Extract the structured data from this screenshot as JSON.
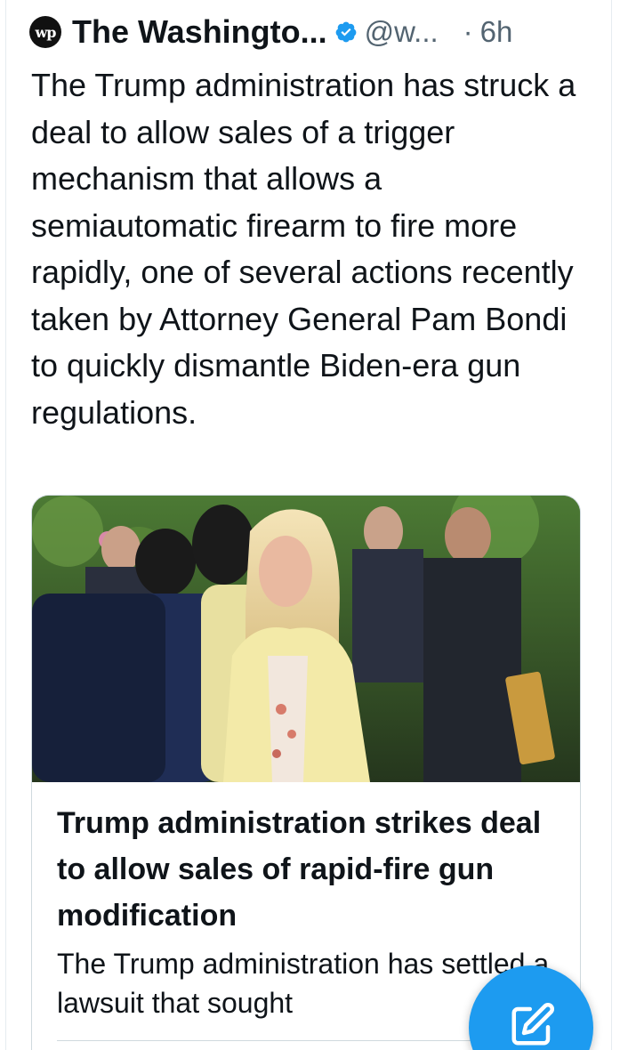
{
  "tweet": {
    "author_name": "The Washingto...",
    "logo_text": "wp",
    "handle": "@w...",
    "separator": "·",
    "time": "6h",
    "text": "The Trump administration has struck a deal to allow sales of a trigger mechanism that allows a semiautomatic firearm to fire more rapidly, one of several actions recently taken by Attorney General Pam Bondi to quickly dismantle Biden-era gun regulations."
  },
  "card": {
    "title": "Trump administration strikes deal to allow sales of rapid-fire gun modification",
    "description": "The Trump administration has settled a lawsuit that sought"
  },
  "colors": {
    "accent": "#1d9bf0",
    "text": "#0f1419",
    "secondary": "#536471"
  },
  "icons": {
    "verified": "verified-badge-icon",
    "compose": "compose-icon"
  }
}
